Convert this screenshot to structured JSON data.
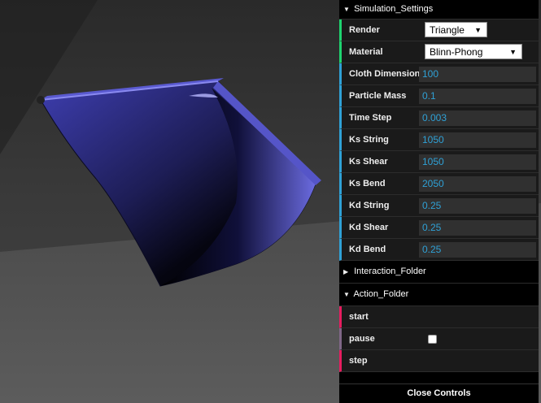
{
  "gui": {
    "simulation_folder": {
      "title": "Simulation_Settings",
      "render": {
        "label": "Render",
        "value": "Triangle"
      },
      "material": {
        "label": "Material",
        "value": "Blinn-Phong"
      },
      "params": [
        {
          "label": "Cloth Dimension",
          "value": "100"
        },
        {
          "label": "Particle Mass",
          "value": "0.1"
        },
        {
          "label": "Time Step",
          "value": "0.003"
        },
        {
          "label": "Ks String",
          "value": "1050"
        },
        {
          "label": "Ks Shear",
          "value": "1050"
        },
        {
          "label": "Ks Bend",
          "value": "2050"
        },
        {
          "label": "Kd String",
          "value": "0.25"
        },
        {
          "label": "Kd Shear",
          "value": "0.25"
        },
        {
          "label": "Kd Bend",
          "value": "0.25"
        }
      ]
    },
    "interaction_folder": {
      "title": "Interaction_Folder"
    },
    "action_folder": {
      "title": "Action_Folder",
      "start": "start",
      "pause": "pause",
      "step": "step"
    },
    "close_label": "Close Controls"
  },
  "colors": {
    "cloth": "#3d3da8",
    "number_accent": "#2fa1d6",
    "select_accent": "#1ed36f",
    "function_accent": "#e61d5f",
    "boolean_accent": "#806787"
  }
}
